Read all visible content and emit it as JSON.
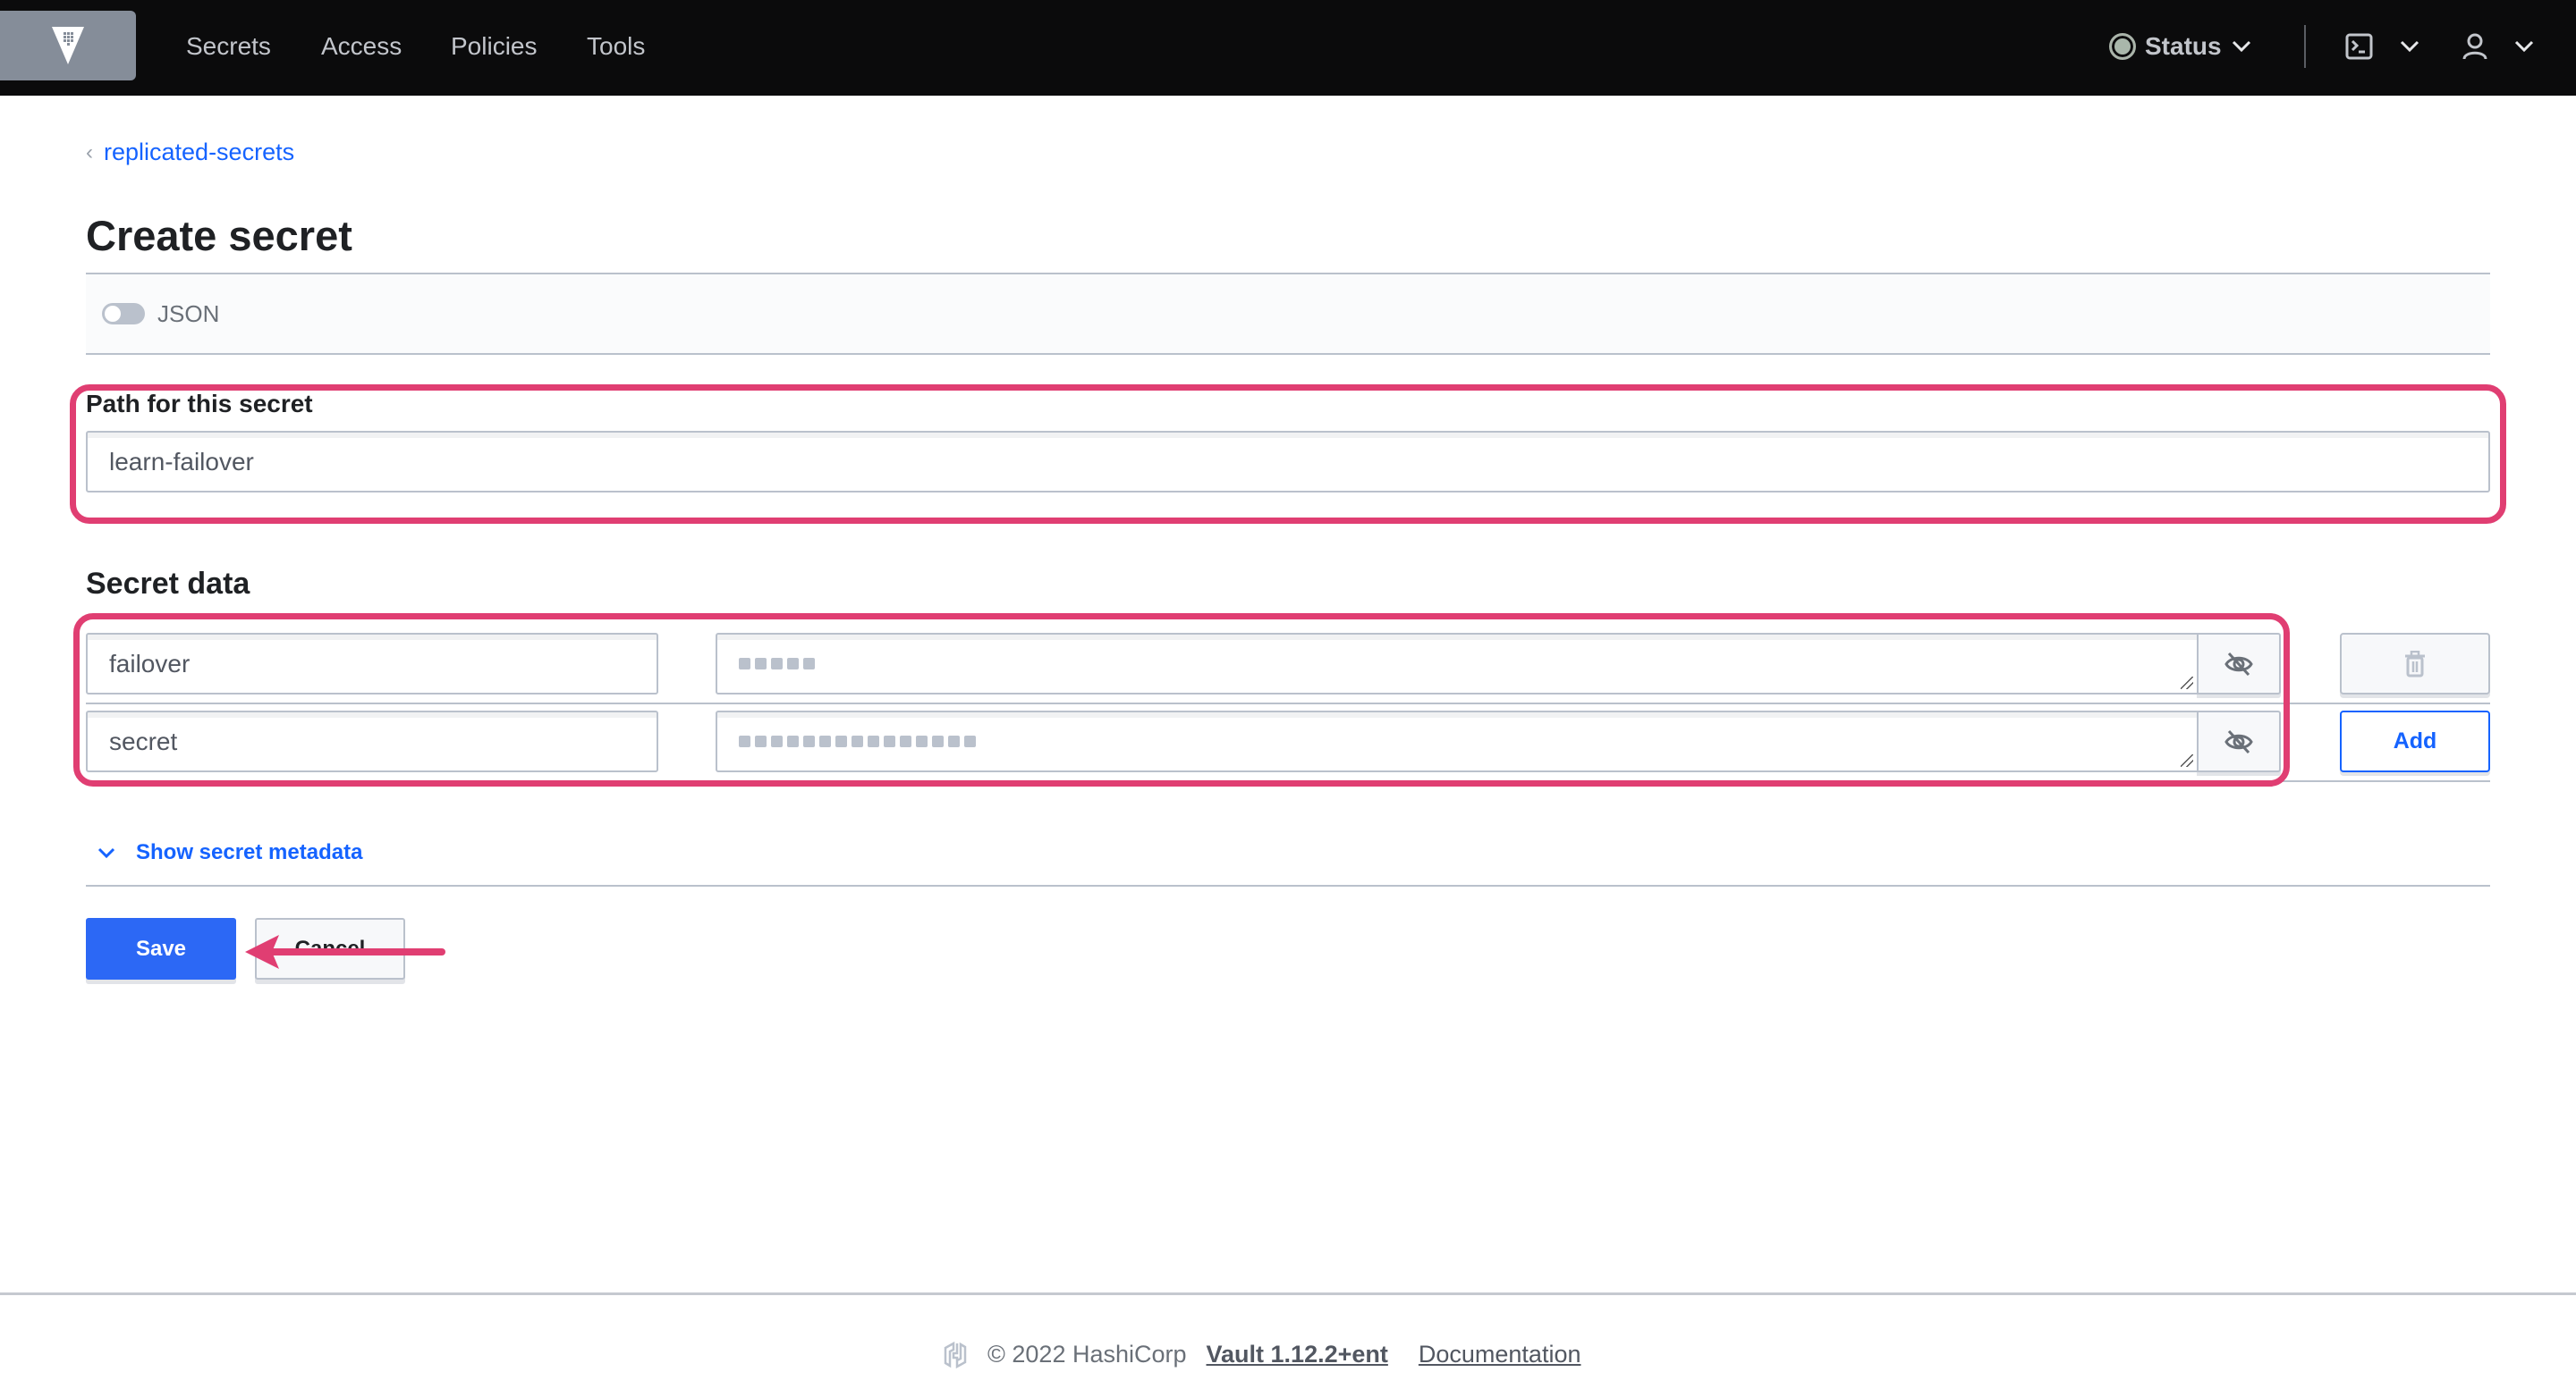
{
  "header": {
    "logo": "vault-logo",
    "nav": [
      "Secrets",
      "Access",
      "Policies",
      "Tools"
    ],
    "status_label": "Status",
    "icons": [
      "status-dot-icon",
      "terminal-icon",
      "user-icon",
      "chevron-down-icon"
    ]
  },
  "breadcrumb": {
    "label": "replicated-secrets"
  },
  "page": {
    "title": "Create secret",
    "json_toggle_label": "JSON",
    "json_toggle_on": false
  },
  "path": {
    "label": "Path for this secret",
    "value": "learn-failover"
  },
  "secret_data": {
    "heading": "Secret data",
    "rows": [
      {
        "key": "failover",
        "masked_length": 5
      },
      {
        "key": "secret",
        "masked_length": 15
      }
    ],
    "delete_icon": "trash-icon",
    "add_label": "Add",
    "reveal_icon": "eye-off-icon"
  },
  "metadata": {
    "label": "Show secret metadata"
  },
  "actions": {
    "save": "Save",
    "cancel": "Cancel"
  },
  "annotations": {
    "highlight_color": "#e03e72",
    "arrow_target": "Save"
  },
  "footer": {
    "copyright": "© 2022 HashiCorp",
    "version": "Vault 1.12.2+ent",
    "docs": "Documentation"
  },
  "colors": {
    "accent": "#1563ff",
    "header_bg": "#0b0b0c",
    "save_bg": "#2c68f5"
  }
}
